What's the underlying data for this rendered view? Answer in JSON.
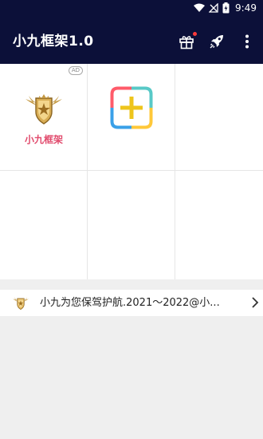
{
  "status_bar": {
    "time": "9:49",
    "icons": [
      "wifi-icon",
      "signal-off-icon",
      "battery-charging-icon"
    ]
  },
  "app_bar": {
    "title": "小九框架1.0",
    "actions": [
      {
        "name": "gift-icon",
        "has_badge": true,
        "badge_color": "#ff3b3b"
      },
      {
        "name": "rocket-icon"
      },
      {
        "name": "more-vertical-icon"
      }
    ],
    "background": "#0c1039"
  },
  "grid": {
    "columns": 3,
    "rows": 2,
    "items": [
      {
        "label": "小九框架",
        "badge": "AD",
        "icon": "shield-emblem-icon",
        "label_color": "#e14a6c"
      },
      {
        "label": "",
        "icon": "add-app-icon"
      },
      {
        "label": ""
      },
      {
        "label": ""
      },
      {
        "label": ""
      },
      {
        "label": ""
      }
    ]
  },
  "footer": {
    "text": "小九为您保驾护航.2021～2022@小...",
    "icon": "shield-emblem-icon",
    "arrow": "chevron-right-icon"
  }
}
